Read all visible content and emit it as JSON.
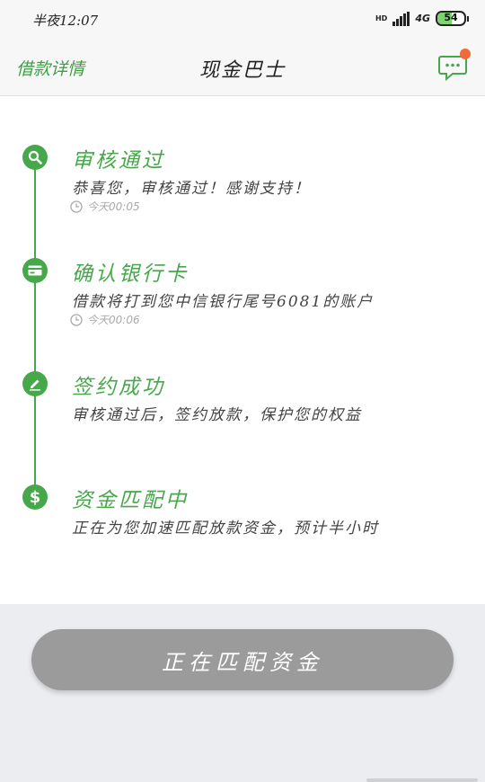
{
  "status_bar": {
    "time": "半夜12:07",
    "hd": "HD",
    "network": "4G",
    "battery": "54"
  },
  "header": {
    "back_label": "借款详情",
    "title": "现金巴士"
  },
  "steps": [
    {
      "title": "审核通过",
      "desc": "恭喜您，审核通过！感谢支持！",
      "time": "今天00:05",
      "icon": "search-icon"
    },
    {
      "title": "确认银行卡",
      "desc": "借款将打到您中信银行尾号6081的账户",
      "time": "今天00:06",
      "icon": "bank-card-icon"
    },
    {
      "title": "签约成功",
      "desc": "审核通过后，签约放款，保护您的权益",
      "icon": "pen-icon"
    },
    {
      "title": "资金匹配中",
      "desc": "正在为您加速匹配放款资金，预计半小时",
      "icon": "dollar-icon"
    }
  ],
  "button": {
    "label": "正在匹配资金"
  },
  "colors": {
    "accent": "#46a84a",
    "badge": "#f06a3b",
    "button_bg": "#9b9b9b"
  }
}
